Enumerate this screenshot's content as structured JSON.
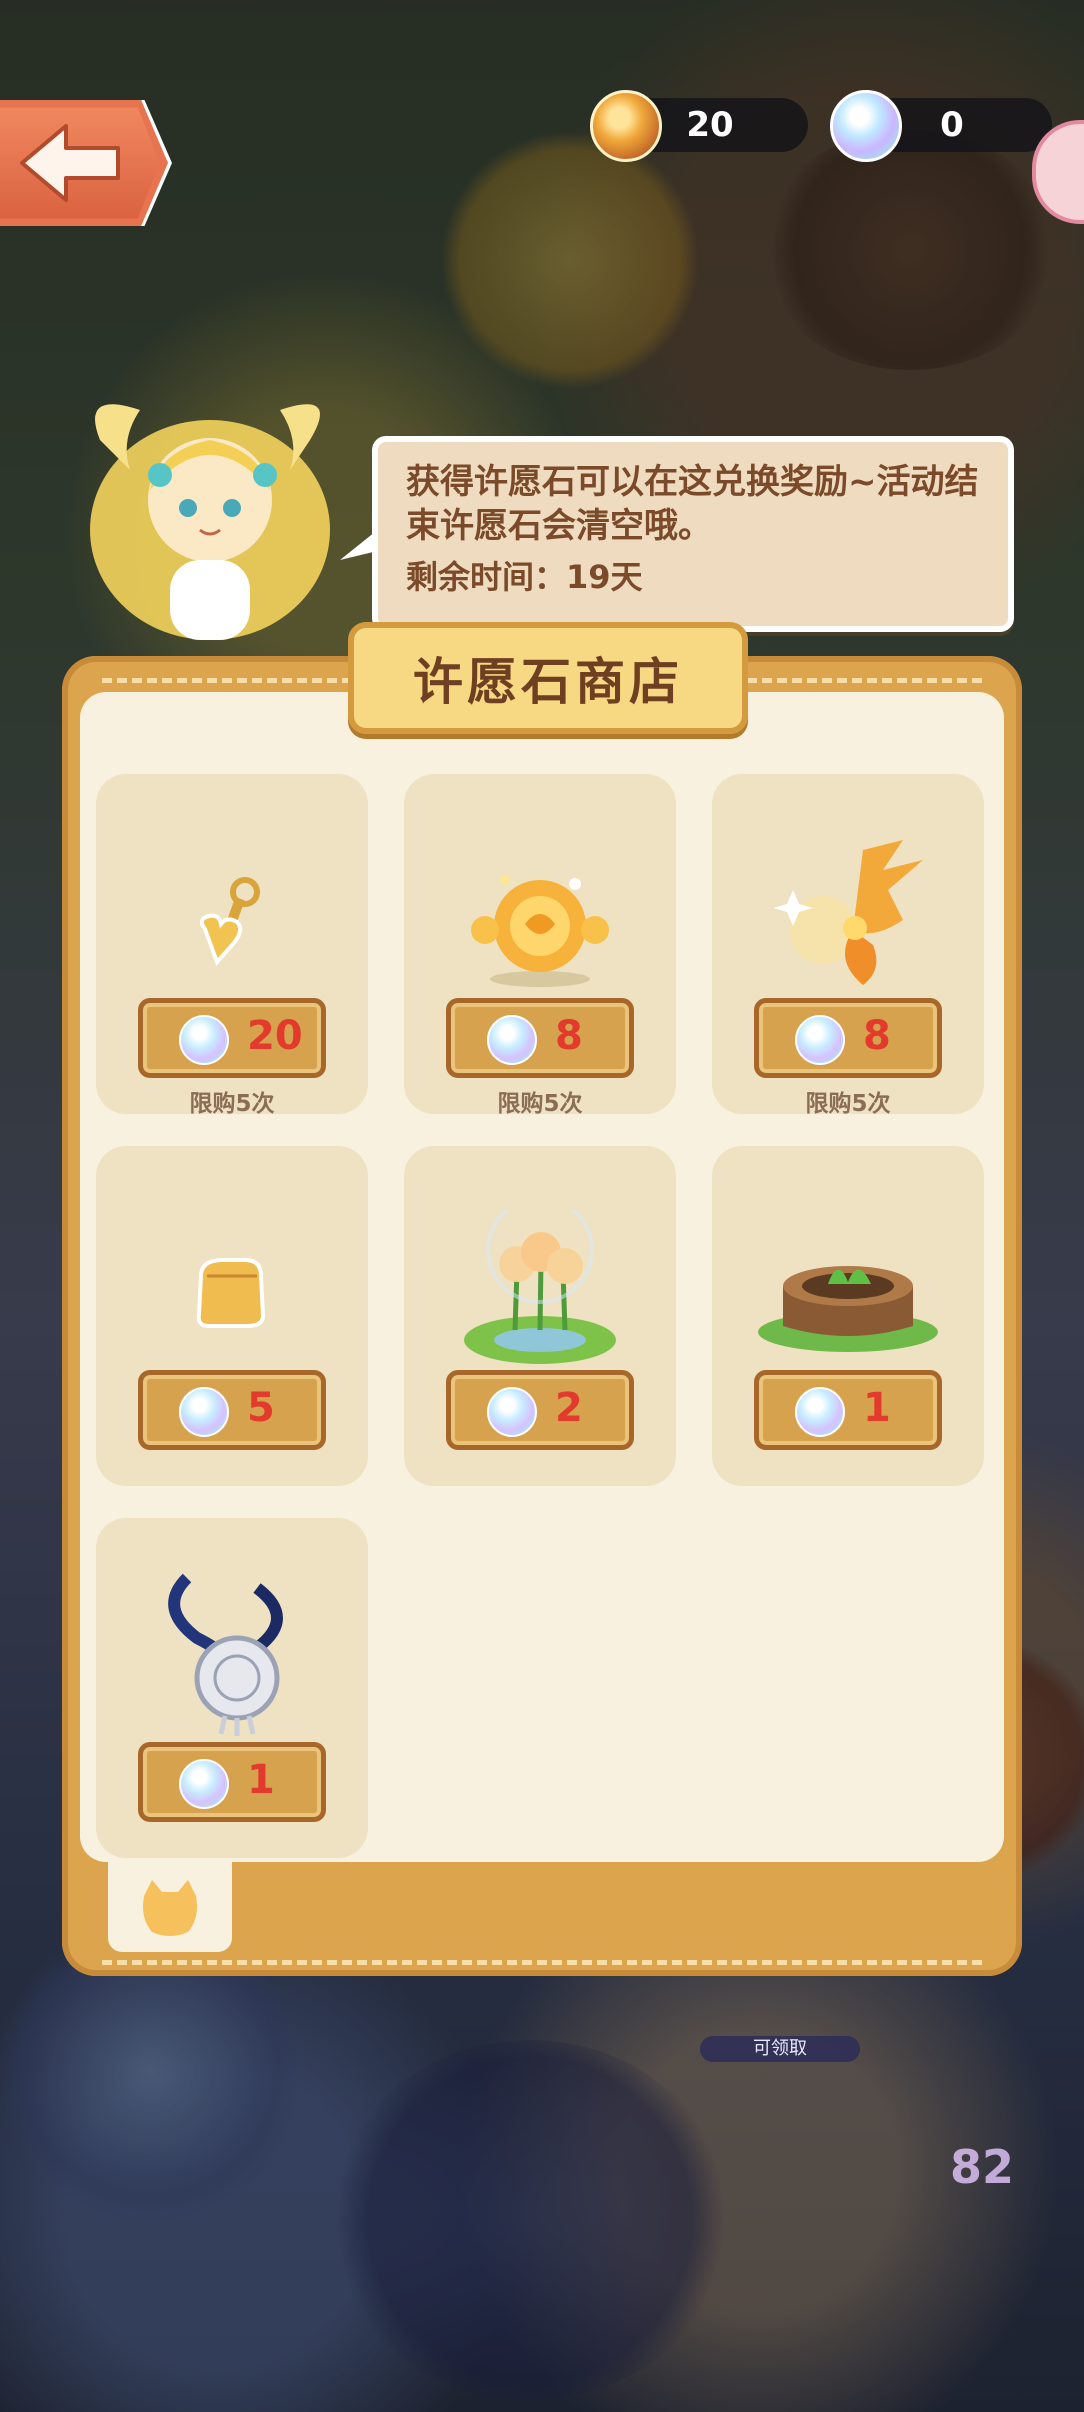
{
  "currencies": [
    {
      "icon": "coin-icon",
      "value": "20"
    },
    {
      "icon": "wish-stone-icon",
      "value": "0"
    }
  ],
  "bubble": {
    "text": "获得许愿石可以在这兑换奖励~活动结束许愿石会清空哦。",
    "remaining_time": "剩余时间：19天"
  },
  "shop": {
    "title": "许愿石商店",
    "items": [
      {
        "art": "heart-key-icon",
        "price": "20",
        "limit": "限购5次"
      },
      {
        "art": "golden-rose-orb-icon",
        "price": "8",
        "limit": "限购5次"
      },
      {
        "art": "golden-phoenix-icon",
        "price": "8",
        "limit": "限购5次"
      },
      {
        "art": "golden-block-icon",
        "price": "5",
        "limit": ""
      },
      {
        "art": "flower-pond-icon",
        "price": "2",
        "limit": ""
      },
      {
        "art": "tree-stump-planter-icon",
        "price": "1",
        "limit": ""
      },
      {
        "art": "silver-medal-pendant-icon",
        "price": "1",
        "limit": ""
      }
    ]
  },
  "background": {
    "claimable_label": "可领取",
    "level_number": "82"
  },
  "colors": {
    "panel": "#dca44d",
    "panel_inner": "#f8f1df",
    "card": "#efe2c2",
    "price_text": "#e23a2c",
    "title_text": "#6e3f21"
  }
}
